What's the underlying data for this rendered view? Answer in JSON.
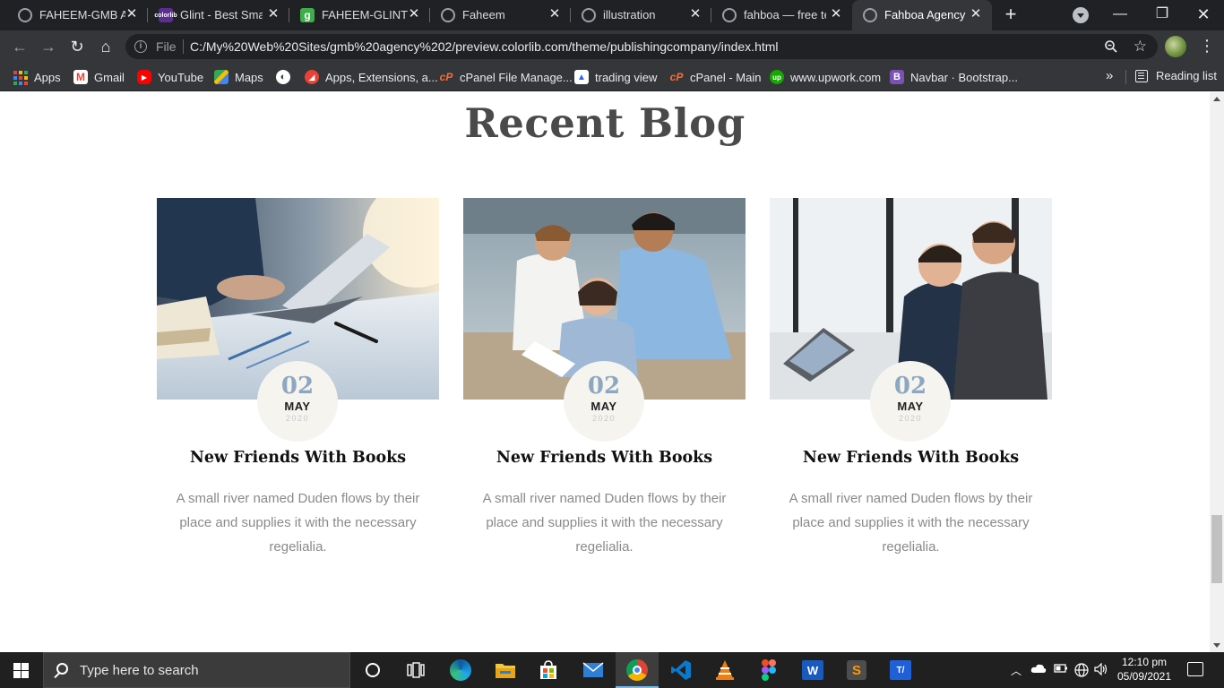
{
  "browser": {
    "tabs": [
      {
        "title": "FAHEEM-GMB AC",
        "icon": "globe-icon",
        "color": "#9aa0a6"
      },
      {
        "title": "Glint - Best Small",
        "icon": "colorlib-icon",
        "color": "#6b3fa0",
        "glyph": "c"
      },
      {
        "title": "FAHEEM-GLINT",
        "icon": "g-icon",
        "color": "#3fae49",
        "glyph": "g"
      },
      {
        "title": "Faheem",
        "icon": "globe-icon",
        "color": "#9aa0a6"
      },
      {
        "title": "illustration",
        "icon": "globe-icon",
        "color": "#9aa0a6"
      },
      {
        "title": "fahboa — free te",
        "icon": "globe-icon",
        "color": "#9aa0a6"
      },
      {
        "title": "Fahboa Agency",
        "icon": "globe-icon",
        "color": "#9aa0a6",
        "active": true
      }
    ],
    "address": {
      "scheme": "File",
      "url": "C:/My%20Web%20Sites/gmb%20agency%202/preview.colorlib.com/theme/publishingcompany/index.html"
    },
    "bookmarks": [
      {
        "label": "Apps",
        "icon": "apps-grid-icon"
      },
      {
        "label": "Gmail",
        "icon": "gmail-icon",
        "color": "#ea4335",
        "glyph": "M"
      },
      {
        "label": "YouTube",
        "icon": "youtube-icon",
        "color": "#ff0000",
        "glyph": "▶"
      },
      {
        "label": "Maps",
        "icon": "maps-icon",
        "color": "#34a853",
        "glyph": "◆"
      },
      {
        "label": "",
        "icon": "globe-icon",
        "color": "#ffffff"
      },
      {
        "label": "Apps, Extensions, a...",
        "icon": "extensions-icon",
        "color": "#e94235",
        "glyph": "◢"
      },
      {
        "label": "cPanel File Manage...",
        "icon": "cpanel-icon",
        "color": "#ff6c2c",
        "glyph": "cP"
      },
      {
        "label": "trading view",
        "icon": "tradingview-icon",
        "color": "#2962ff",
        "glyph": "⛰"
      },
      {
        "label": "cPanel - Main",
        "icon": "cpanel-icon",
        "color": "#ff6c2c",
        "glyph": "cP"
      },
      {
        "label": "www.upwork.com",
        "icon": "upwork-icon",
        "color": "#14a800",
        "glyph": "up"
      },
      {
        "label": "Navbar · Bootstrap...",
        "icon": "bootstrap-icon",
        "color": "#7952b3",
        "glyph": "B"
      }
    ],
    "more_label": "»",
    "reading_list": "Reading list"
  },
  "page": {
    "section_title": "Recent Blog",
    "posts": [
      {
        "day": "02",
        "month": "MAY",
        "year": "2020",
        "title": "New Friends With Books",
        "excerpt": "A small river named Duden flows by their place and supplies it with the necessary regelialia."
      },
      {
        "day": "02",
        "month": "MAY",
        "year": "2020",
        "title": "New Friends With Books",
        "excerpt": "A small river named Duden flows by their place and supplies it with the necessary regelialia."
      },
      {
        "day": "02",
        "month": "MAY",
        "year": "2020",
        "title": "New Friends With Books",
        "excerpt": "A small river named Duden flows by their place and supplies it with the necessary regelialia."
      }
    ]
  },
  "taskbar": {
    "search_placeholder": "Type here to search",
    "time": "12:10 pm",
    "date": "05/09/2021",
    "apps": [
      "cortana-icon",
      "task-view-icon",
      "edge-icon",
      "file-explorer-icon",
      "store-icon",
      "mail-icon",
      "chrome-icon",
      "vscode-icon",
      "vlc-icon",
      "figma-icon",
      "word-icon",
      "sublime-icon",
      "typora-icon"
    ]
  }
}
